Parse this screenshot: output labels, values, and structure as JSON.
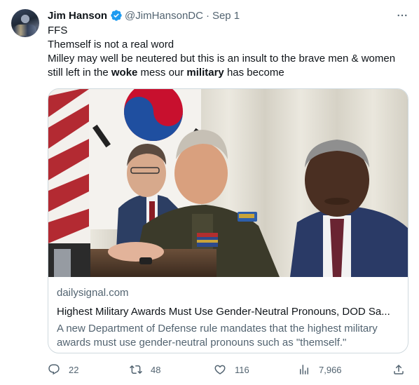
{
  "tweet": {
    "author_name": "Jim Hanson",
    "author_handle": "@JimHansonDC",
    "separator": "·",
    "date": "Sep 1",
    "text": {
      "line1": "FFS",
      "line2": "Themself is not a real word",
      "line3_pre": "Milley may well be neutered but this is an insult to the brave men & women still left in the ",
      "line3_bold1": "woke",
      "line3_mid": " mess our ",
      "line3_bold2": "military",
      "line3_post": " has become"
    },
    "card": {
      "domain": "dailysignal.com",
      "headline": "Highest Military Awards Must Use Gender-Neutral Pronouns, DOD Sa...",
      "description": "A new Department of Defense rule mandates that the highest military awards must use gender-neutral pronouns such as \"themself.\""
    },
    "actions": {
      "replies": "22",
      "retweets": "48",
      "likes": "116",
      "views": "7,966"
    },
    "icons": {
      "verified": "verified-badge-icon",
      "more": "more-icon",
      "reply": "reply-icon",
      "retweet": "retweet-icon",
      "like": "heart-icon",
      "views": "views-icon",
      "share": "share-icon"
    },
    "colors": {
      "verified_blue": "#1d9bf0",
      "secondary_text": "#536471",
      "primary_text": "#0f1419",
      "border": "#cfd9de"
    }
  }
}
